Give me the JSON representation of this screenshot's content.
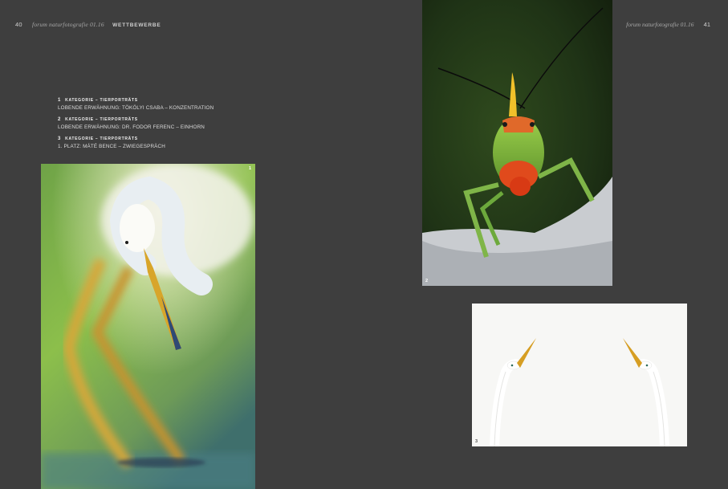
{
  "left_page": {
    "page_number": "40",
    "magazine": "forum naturfotografie 01.16",
    "section": "WETTBEWERBE"
  },
  "right_page": {
    "page_number": "41",
    "magazine": "forum naturfotografie 01.16"
  },
  "captions": [
    {
      "number": "1",
      "category": "KATEGORIE – TIERPORTRÄTS",
      "text": "LOBENDE ERWÄHNUNG: TÖKÖLYI CSABA – KONZENTRATION"
    },
    {
      "number": "2",
      "category": "KATEGORIE – TIERPORTRÄTS",
      "text": "LOBENDE ERWÄHNUNG: DR. FODOR FERENC – EINHORN"
    },
    {
      "number": "3",
      "category": "KATEGORIE – TIERPORTRÄTS",
      "text": "1. PLATZ: MÁTÉ BENCE – ZWIEGESPRÄCH"
    }
  ],
  "photos": [
    {
      "number": "1",
      "icon": "heron-photo"
    },
    {
      "number": "2",
      "icon": "katydid-photo"
    },
    {
      "number": "3",
      "icon": "egrets-photo"
    }
  ],
  "colors": {
    "background": "#3e3e3e",
    "text": "#e4e4e4"
  }
}
